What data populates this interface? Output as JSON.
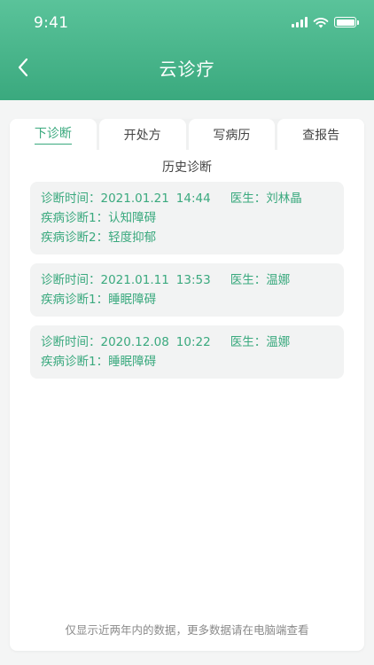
{
  "status_bar": {
    "time": "9:41"
  },
  "nav": {
    "title": "云诊疗"
  },
  "tabs": [
    {
      "label": "下诊断",
      "active": true
    },
    {
      "label": "开处方",
      "active": false
    },
    {
      "label": "写病历",
      "active": false
    },
    {
      "label": "查报告",
      "active": false
    }
  ],
  "history": {
    "title": "历史诊断",
    "records": [
      {
        "time_label": "诊断时间：",
        "date": "2021.01.21",
        "time": "14:44",
        "doctor_label": "医生：",
        "doctor": "刘林晶",
        "diagnoses": [
          {
            "label": "疾病诊断1：",
            "value": "认知障碍"
          },
          {
            "label": "疾病诊断2：",
            "value": "轻度抑郁"
          }
        ]
      },
      {
        "time_label": "诊断时间：",
        "date": "2021.01.11",
        "time": "13:53",
        "doctor_label": "医生：",
        "doctor": "温娜",
        "diagnoses": [
          {
            "label": "疾病诊断1：",
            "value": "睡眠障碍"
          }
        ]
      },
      {
        "time_label": "诊断时间：",
        "date": "2020.12.08",
        "time": "10:22",
        "doctor_label": "医生：",
        "doctor": "温娜",
        "diagnoses": [
          {
            "label": "疾病诊断1：",
            "value": "睡眠障碍"
          }
        ]
      }
    ]
  },
  "footer_note": "仅显示近两年内的数据，更多数据请在电脑端查看",
  "colors": {
    "accent": "#3aa97e",
    "header_top": "#5ac39a",
    "card_bg": "#ffffff",
    "record_bg": "#f2f3f3"
  },
  "icons": {
    "back": "chevron-left-icon",
    "signal": "signal-icon",
    "wifi": "wifi-icon",
    "battery": "battery-icon"
  }
}
